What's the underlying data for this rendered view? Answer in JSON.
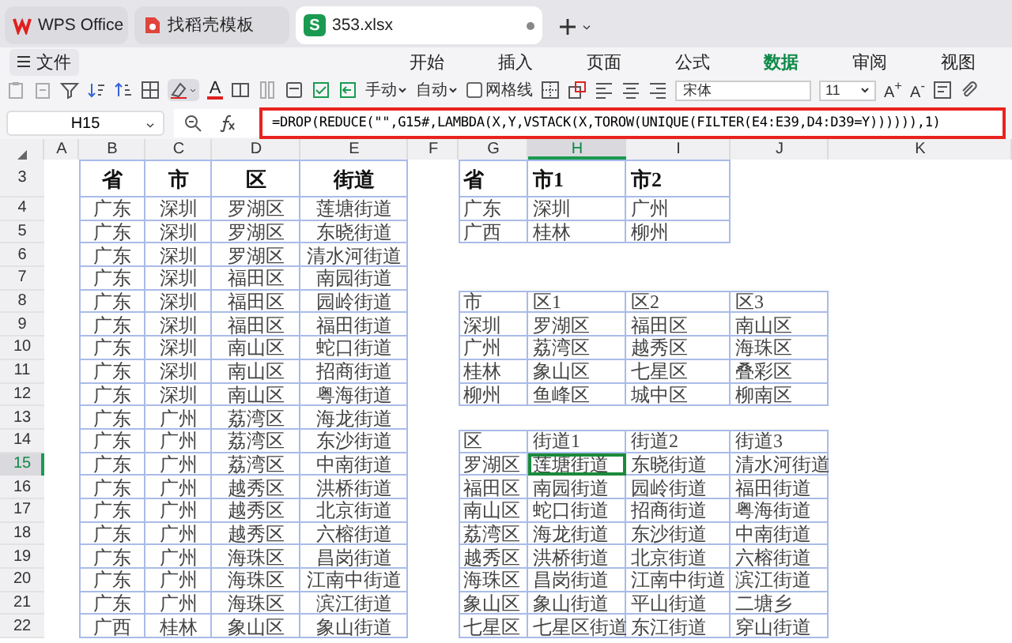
{
  "tabs": [
    {
      "label": "WPS Office",
      "kind": "app",
      "selected": false
    },
    {
      "label": "找稻壳模板",
      "kind": "template",
      "selected": false
    },
    {
      "label": "353.xlsx",
      "kind": "sheet",
      "icon_text": "S",
      "selected": true,
      "modified": true
    }
  ],
  "menu": {
    "file_button": "文件",
    "ribbon_tabs": [
      {
        "label": "开始",
        "selected": false
      },
      {
        "label": "插入",
        "selected": false
      },
      {
        "label": "页面",
        "selected": false
      },
      {
        "label": "公式",
        "selected": false
      },
      {
        "label": "数据",
        "selected": true
      },
      {
        "label": "审阅",
        "selected": false
      },
      {
        "label": "视图",
        "selected": false
      }
    ]
  },
  "toolbar": {
    "font_color": "A",
    "manual": "手动",
    "auto": "自动",
    "gridlines": {
      "label": "网格线",
      "checked": false
    },
    "font": "宋体",
    "size": "11",
    "grow": "A$^{+}$",
    "shrink": "A$^{-}$"
  },
  "formula_bar": {
    "cell_ref": "H15",
    "formula": "=DROP(REDUCE(\"\",G15#,LAMBDA(X,Y,VSTACK(X,TOROW(UNIQUE(FILTER(E4:E39,D4:D39=Y)))))),1)",
    "highlighted": true
  },
  "sheet": {
    "columns": [
      {
        "label": "A",
        "selected": false
      },
      {
        "label": "B",
        "selected": false
      },
      {
        "label": "C",
        "selected": false
      },
      {
        "label": "D",
        "selected": false
      },
      {
        "label": "E",
        "selected": false
      },
      {
        "label": "F",
        "selected": false
      },
      {
        "label": "G",
        "selected": false
      },
      {
        "label": "H",
        "selected": true
      },
      {
        "label": "I",
        "selected": false
      },
      {
        "label": "J",
        "selected": false
      },
      {
        "label": "K",
        "selected": false
      }
    ],
    "rows": [
      {
        "number": "3",
        "selected": false,
        "bold": true,
        "cells": {
          "B": "省",
          "C": "市",
          "D": "区",
          "E": "街道",
          "G": "省",
          "H": "市1",
          "I": "市2"
        }
      },
      {
        "number": "4",
        "selected": false,
        "bold": false,
        "cells": {
          "B": "广东",
          "C": "深圳",
          "D": "罗湖区",
          "E": "莲塘街道",
          "G": "广东",
          "H": "深圳",
          "I": "广州"
        }
      },
      {
        "number": "5",
        "selected": false,
        "bold": false,
        "cells": {
          "B": "广东",
          "C": "深圳",
          "D": "罗湖区",
          "E": "东晓街道",
          "G": "广西",
          "H": "桂林",
          "I": "柳州"
        }
      },
      {
        "number": "6",
        "selected": false,
        "bold": false,
        "cells": {
          "B": "广东",
          "C": "深圳",
          "D": "罗湖区",
          "E": "清水河街道"
        }
      },
      {
        "number": "7",
        "selected": false,
        "bold": false,
        "cells": {
          "B": "广东",
          "C": "深圳",
          "D": "福田区",
          "E": "南园街道"
        }
      },
      {
        "number": "8",
        "selected": false,
        "bold": false,
        "cells": {
          "B": "广东",
          "C": "深圳",
          "D": "福田区",
          "E": "园岭街道",
          "G": "市",
          "H": "区1",
          "I": "区2",
          "J": "区3"
        }
      },
      {
        "number": "9",
        "selected": false,
        "bold": false,
        "cells": {
          "B": "广东",
          "C": "深圳",
          "D": "福田区",
          "E": "福田街道",
          "G": "深圳",
          "H": "罗湖区",
          "I": "福田区",
          "J": "南山区"
        }
      },
      {
        "number": "10",
        "selected": false,
        "bold": false,
        "cells": {
          "B": "广东",
          "C": "深圳",
          "D": "南山区",
          "E": "蛇口街道",
          "G": "广州",
          "H": "荔湾区",
          "I": "越秀区",
          "J": "海珠区"
        }
      },
      {
        "number": "11",
        "selected": false,
        "bold": false,
        "cells": {
          "B": "广东",
          "C": "深圳",
          "D": "南山区",
          "E": "招商街道",
          "G": "桂林",
          "H": "象山区",
          "I": "七星区",
          "J": "叠彩区"
        }
      },
      {
        "number": "12",
        "selected": false,
        "bold": false,
        "cells": {
          "B": "广东",
          "C": "深圳",
          "D": "南山区",
          "E": "粤海街道",
          "G": "柳州",
          "H": "鱼峰区",
          "I": "城中区",
          "J": "柳南区"
        }
      },
      {
        "number": "13",
        "selected": false,
        "bold": false,
        "cells": {
          "B": "广东",
          "C": "广州",
          "D": "荔湾区",
          "E": "海龙街道"
        }
      },
      {
        "number": "14",
        "selected": false,
        "bold": false,
        "cells": {
          "B": "广东",
          "C": "广州",
          "D": "荔湾区",
          "E": "东沙街道",
          "G": "区",
          "H": "街道1",
          "I": "街道2",
          "J": "街道3"
        }
      },
      {
        "number": "15",
        "selected": true,
        "bold": false,
        "cells": {
          "B": "广东",
          "C": "广州",
          "D": "荔湾区",
          "E": "中南街道",
          "G": "罗湖区",
          "H": "莲塘街道",
          "I": "东晓街道",
          "J": "清水河街道"
        }
      },
      {
        "number": "16",
        "selected": false,
        "bold": false,
        "cells": {
          "B": "广东",
          "C": "广州",
          "D": "越秀区",
          "E": "洪桥街道",
          "G": "福田区",
          "H": "南园街道",
          "I": "园岭街道",
          "J": "福田街道"
        }
      },
      {
        "number": "17",
        "selected": false,
        "bold": false,
        "cells": {
          "B": "广东",
          "C": "广州",
          "D": "越秀区",
          "E": "北京街道",
          "G": "南山区",
          "H": "蛇口街道",
          "I": "招商街道",
          "J": "粤海街道"
        }
      },
      {
        "number": "18",
        "selected": false,
        "bold": false,
        "cells": {
          "B": "广东",
          "C": "广州",
          "D": "越秀区",
          "E": "六榕街道",
          "G": "荔湾区",
          "H": "海龙街道",
          "I": "东沙街道",
          "J": "中南街道"
        }
      },
      {
        "number": "19",
        "selected": false,
        "bold": false,
        "cells": {
          "B": "广东",
          "C": "广州",
          "D": "海珠区",
          "E": "昌岗街道",
          "G": "越秀区",
          "H": "洪桥街道",
          "I": "北京街道",
          "J": "六榕街道"
        }
      },
      {
        "number": "20",
        "selected": false,
        "bold": false,
        "cells": {
          "B": "广东",
          "C": "广州",
          "D": "海珠区",
          "E": "江南中街道",
          "G": "海珠区",
          "H": "昌岗街道",
          "I": "江南中街道",
          "J": "滨江街道"
        }
      },
      {
        "number": "21",
        "selected": false,
        "bold": false,
        "cells": {
          "B": "广东",
          "C": "广州",
          "D": "海珠区",
          "E": "滨江街道",
          "G": "象山区",
          "H": "象山街道",
          "I": "平山街道",
          "J": "二塘乡"
        }
      },
      {
        "number": "22",
        "selected": false,
        "bold": false,
        "cells": {
          "B": "广西",
          "C": "桂林",
          "D": "象山区",
          "E": "象山街道",
          "G": "七星区",
          "H": "七星区街道",
          "I": "东江街道",
          "J": "穿山街道"
        }
      }
    ]
  }
}
